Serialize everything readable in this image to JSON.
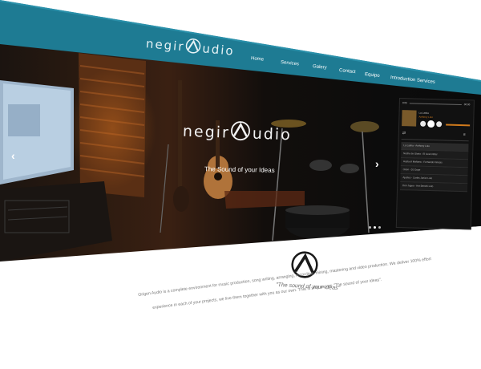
{
  "brand": {
    "logo_left": "negir",
    "logo_right": "udio",
    "colors": {
      "header": "#1e7b93",
      "accent_orange": "#d07a1c",
      "dark": "#0d0d0d"
    }
  },
  "nav": {
    "items": [
      "Home",
      "Services",
      "Galery",
      "Contact",
      "Equipo",
      "Introduction Services"
    ]
  },
  "hero": {
    "logo_left": "negir",
    "logo_right": "udio",
    "tagline": "The Sound of your Ideas",
    "prev_icon": "chevron-left-icon",
    "next_icon": "chevron-right-icon",
    "slides": 3,
    "active_slide": 1
  },
  "player": {
    "time_left": "0:00",
    "time_right": "00:00",
    "track_title": "La Latina",
    "track_artist": "Anthony Lolo",
    "playlist": [
      "La Latina - Anthony Lolo",
      "Noche de Gloria - El Gran Rider",
      "Hasta el Mañana - Fernando Kinesis",
      "Orion - DJ Dope",
      "Ajustes - Carlos Junior Lolo",
      "Don Juges - Hot Benchi Lolo"
    ]
  },
  "about": {
    "quote": "\"The sound of your ideas\"",
    "text_line1": "Origen Audio is a complete environment for music production, song writing, arranging, recording, mixing, mastering and video production. We deliver 100% effort",
    "text_line2": "experience in each of your projects, we live them together with you as our own. That is why we are \"The sound of your ideas\"."
  }
}
